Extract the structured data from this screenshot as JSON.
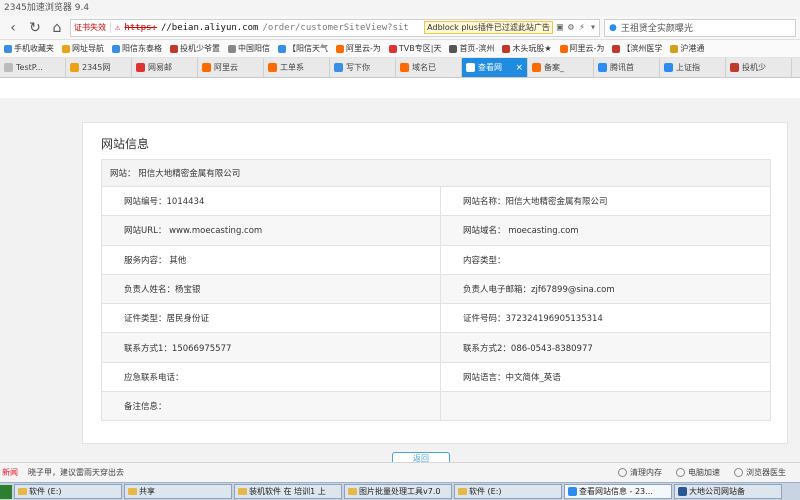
{
  "window": {
    "title": "2345加速浏览器 9.4"
  },
  "nav": {
    "cert_label": "证书失效",
    "url_proto": "https:",
    "url_host": "//beian.aliyun.com",
    "url_path": "/order/customerSiteView?sit",
    "adblock_text": "Adblock plus插件已过滤此站广告",
    "search_text": "王祖贤全实颜曝光"
  },
  "bookmarks": [
    {
      "label": "手机收藏夹",
      "color": "#3a8ee6"
    },
    {
      "label": "网址导航",
      "color": "#e8a317"
    },
    {
      "label": "阳信东泰格",
      "color": "#3a8ee6"
    },
    {
      "label": "投机少爷置",
      "color": "#c0392b"
    },
    {
      "label": "中国阳信",
      "color": "#888888"
    },
    {
      "label": "【阳信天气",
      "color": "#3a8ee6"
    },
    {
      "label": "阿里云-为",
      "color": "#ff6a00"
    },
    {
      "label": "TVB专区|天",
      "color": "#d33"
    },
    {
      "label": "首页-滨州",
      "color": "#555555"
    },
    {
      "label": "木头玩股★",
      "color": "#c0392b"
    },
    {
      "label": "阿里云-为",
      "color": "#ff6a00"
    },
    {
      "label": "【滨州医学",
      "color": "#c0392b"
    },
    {
      "label": "沪港通",
      "color": "#d4a017"
    }
  ],
  "tabs": [
    {
      "label": "TestP...",
      "color": "#bbbbbb",
      "active": false
    },
    {
      "label": "2345网",
      "color": "#e8a317",
      "active": false
    },
    {
      "label": "网易邮",
      "color": "#d33",
      "active": false
    },
    {
      "label": "阿里云",
      "color": "#ff6a00",
      "active": false
    },
    {
      "label": "工单系",
      "color": "#ff6a00",
      "active": false
    },
    {
      "label": "写下你",
      "color": "#3a8ee6",
      "active": false
    },
    {
      "label": "域名已",
      "color": "#ff6a00",
      "active": false
    },
    {
      "label": "查看网",
      "color": "#ffffff",
      "active": true
    },
    {
      "label": "备案_",
      "color": "#ff6a00",
      "active": false
    },
    {
      "label": "腾讯首",
      "color": "#2d8cf0",
      "active": false
    },
    {
      "label": "上证指",
      "color": "#2d8cf0",
      "active": false
    },
    {
      "label": "投机少",
      "color": "#c0392b",
      "active": false
    }
  ],
  "site_info": {
    "title": "网站信息",
    "website_row": "网站：  阳信大地精密金属有限公司",
    "rows": [
      {
        "left": "网站编号：1014434",
        "right": "网站名称：阳信大地精密金属有限公司"
      },
      {
        "left": "网站URL：  www.moecasting.com",
        "right": "网站域名：  moecasting.com"
      },
      {
        "left": "服务内容：  其他",
        "right": "内容类型："
      },
      {
        "left": "负责人姓名：杨宝银",
        "right": "负责人电子邮箱：zjf67899@sina.com"
      },
      {
        "left": "证件类型：居民身份证",
        "right": "证件号码：372324196905135314"
      },
      {
        "left": "联系方式1：15066975577",
        "right": "联系方式2：086-0543-8380977"
      },
      {
        "left": "应急联系电话：",
        "right": "网站语言：中文简体_英语"
      },
      {
        "left": "备注信息：",
        "right": ""
      }
    ],
    "button_label": "返回"
  },
  "status": {
    "news": "新闻",
    "text": "晓子甲，建议雷雨天穿出去",
    "items": [
      "清理内存",
      "电脑加速",
      "浏览器医生"
    ]
  },
  "taskbar": [
    {
      "label": "软件 (E:)",
      "kind": "folder",
      "color": "#e6b84a"
    },
    {
      "label": "共享",
      "kind": "folder",
      "color": "#e6b84a"
    },
    {
      "label": "装机软件 在 培训1 上",
      "kind": "folder",
      "color": "#e6b84a"
    },
    {
      "label": "图片批量处理工具v7.0",
      "kind": "folder",
      "color": "#e6b84a"
    },
    {
      "label": "软件 (E:)",
      "kind": "folder",
      "color": "#e6b84a"
    },
    {
      "label": "查看网站信息 - 23...",
      "kind": "app",
      "color": "#2d8cf0"
    },
    {
      "label": "大地公司网站备",
      "kind": "app",
      "color": "#2b5797"
    }
  ]
}
